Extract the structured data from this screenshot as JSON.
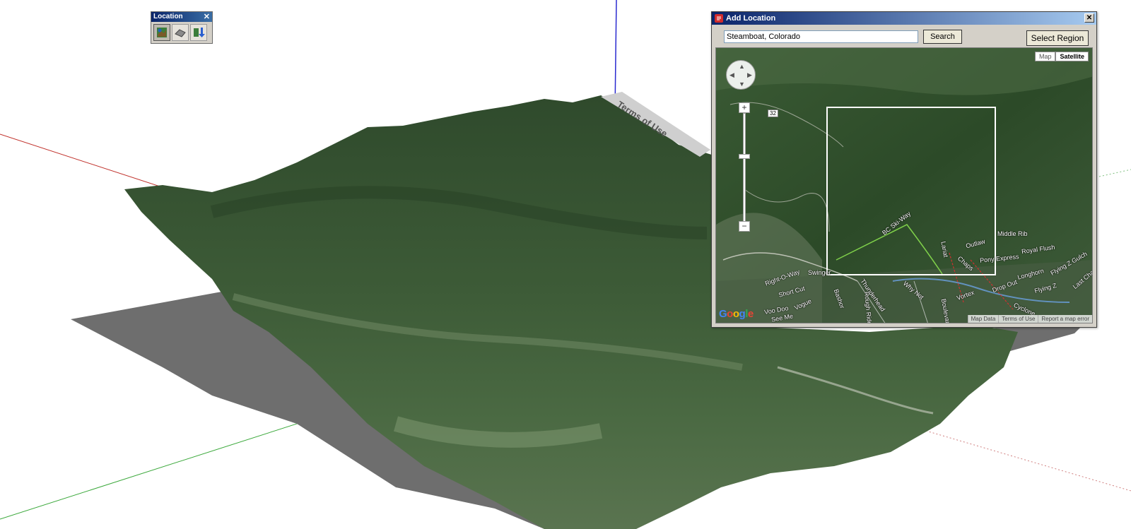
{
  "toolbar": {
    "title": "Location",
    "close_glyph": "✕",
    "buttons": [
      {
        "icon": "add-location-icon",
        "active": true
      },
      {
        "icon": "toggle-terrain-icon",
        "active": false
      },
      {
        "icon": "photo-textures-icon",
        "active": false
      }
    ]
  },
  "scene": {
    "terms_label": "Terms of Use",
    "axis_colors": {
      "red": "#c0302a",
      "green": "#3aa83a",
      "blue": "#2a2ad0"
    },
    "ground_shadow_color": "#6e6e6e",
    "terrain_color": "#3e5a38"
  },
  "dialog": {
    "title": "Add Location",
    "close_glyph": "✕",
    "search": {
      "value": "Steamboat, Colorado",
      "button": "Search"
    },
    "select_region": "Select Region",
    "map_types": {
      "map": "Map",
      "satellite": "Satellite"
    },
    "zoom": {
      "plus": "+",
      "minus": "−"
    },
    "route_badge": "32",
    "trail_labels": [
      "BC Ski-Way",
      "Middle Rib",
      "Royal Flush",
      "Pony Express",
      "Outlaw",
      "Lariat",
      "Longhorn",
      "Flying Z Gulch",
      "Flying Z",
      "Drop Out",
      "Vortex",
      "Right-O-Way",
      "Short Cut",
      "Swinger",
      "Vogue",
      "Voo Doo",
      "Thunderhead",
      "Why Not",
      "See Me",
      "Chaps",
      "Rough Rider",
      "Cyclone",
      "Last Chance",
      "Boulevard",
      "Bashor"
    ],
    "google": "Google",
    "attribution": [
      "Map Data",
      "Terms of Use",
      "Report a map error"
    ]
  }
}
